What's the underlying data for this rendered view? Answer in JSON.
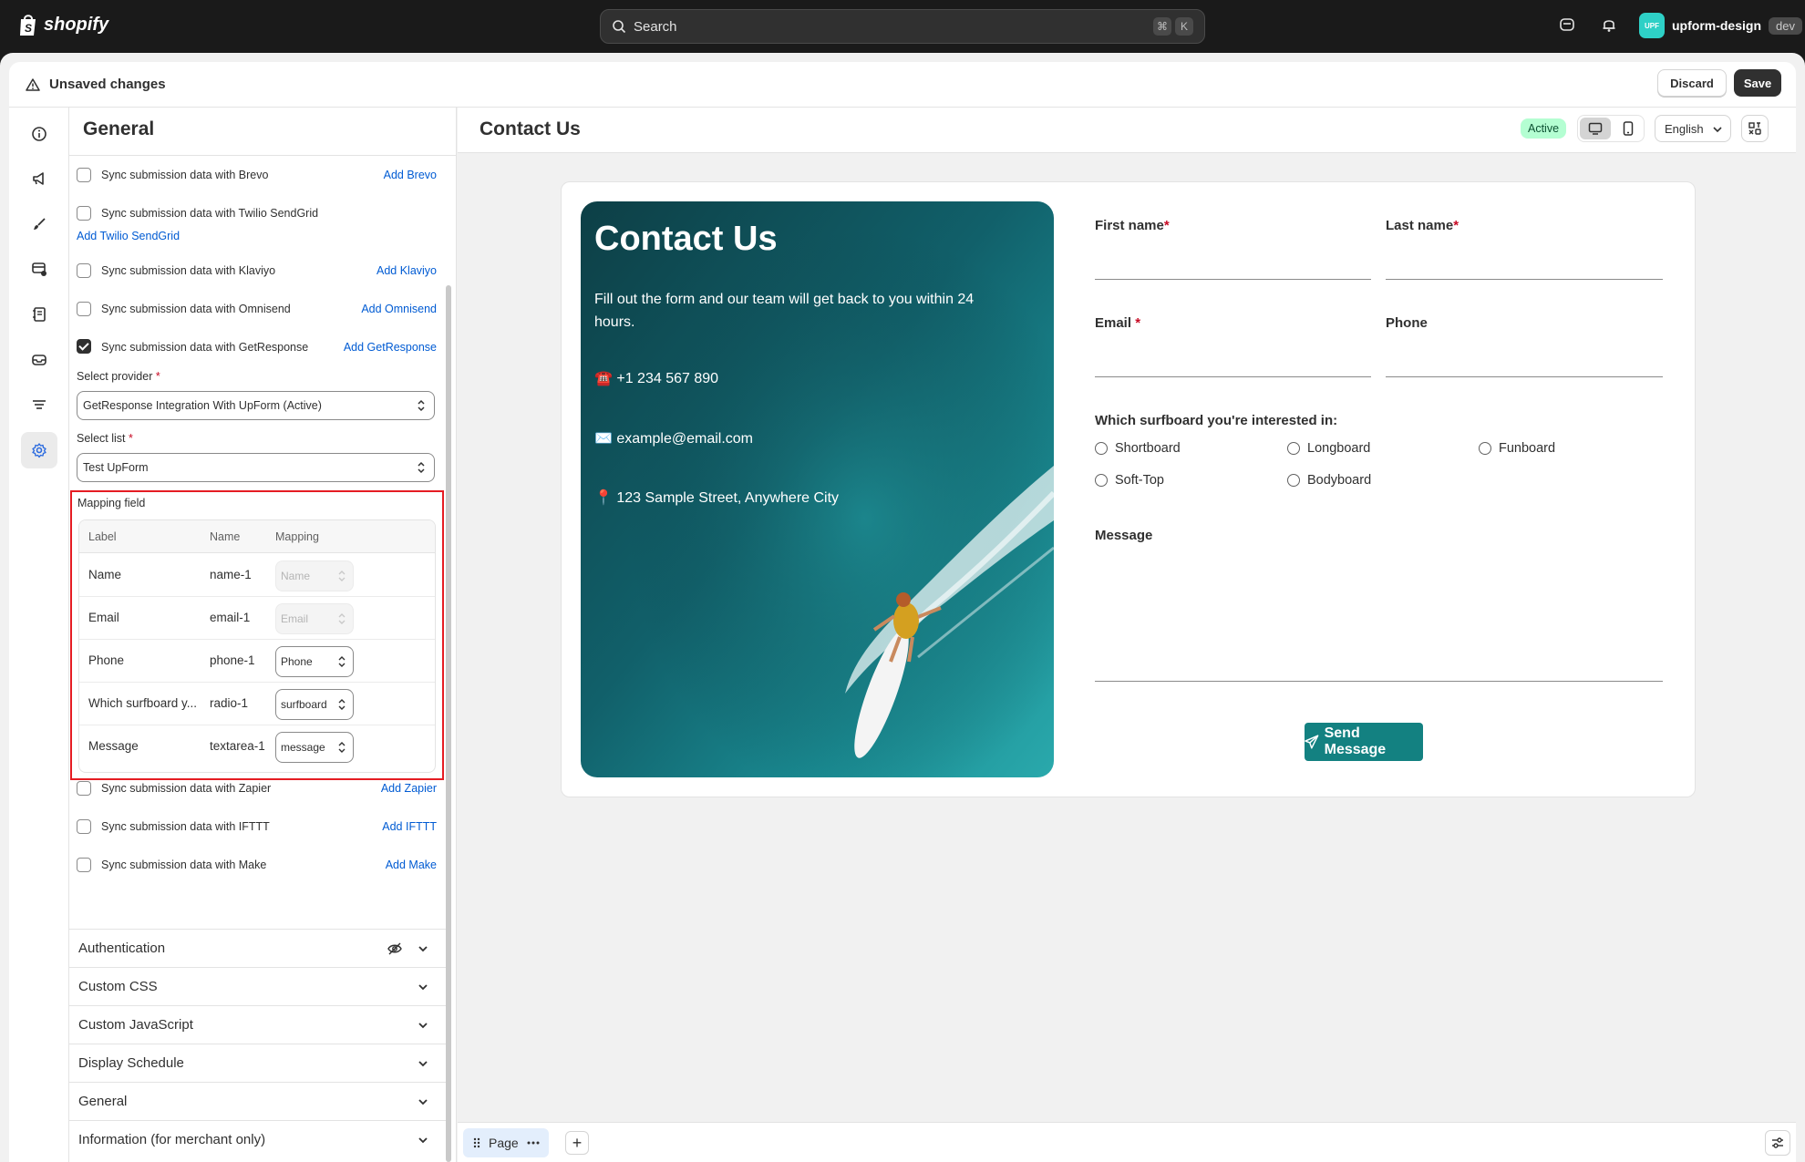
{
  "topbar": {
    "brand": "shopify",
    "search_placeholder": "Search",
    "shortcut_keys": [
      "⌘",
      "K"
    ],
    "store_avatar": "UPF",
    "store_name": "upform-design",
    "store_badge": "dev"
  },
  "savebar": {
    "title": "Unsaved changes",
    "discard_label": "Discard",
    "save_label": "Save"
  },
  "rail": {
    "icons": [
      "info-icon",
      "megaphone-icon",
      "brush-icon",
      "payment-icon",
      "notebook-icon",
      "email-icon",
      "filter-icon",
      "gear-icon"
    ],
    "active": "gear-icon"
  },
  "panel": {
    "title": "General",
    "integrations_top": [
      {
        "label": "Sync submission data with Brevo",
        "link": "Add Brevo",
        "checked": false
      },
      {
        "label": "Sync submission data with Twilio SendGrid",
        "link": "Add Twilio SendGrid",
        "checked": false
      },
      {
        "label": "Sync submission data with Klaviyo",
        "link": "Add Klaviyo",
        "checked": false
      },
      {
        "label": "Sync submission data with Omnisend",
        "link": "Add Omnisend",
        "checked": false
      },
      {
        "label": "Sync submission data with GetResponse",
        "link": "Add GetResponse",
        "checked": true
      }
    ],
    "provider": {
      "label": "Select provider",
      "required_mark": "*",
      "value": "GetResponse Integration With UpForm (Active)"
    },
    "list": {
      "label": "Select list",
      "required_mark": "*",
      "value": "Test UpForm"
    },
    "mapping": {
      "title": "Mapping field",
      "headers": [
        "Label",
        "Name",
        "Mapping"
      ],
      "rows": [
        {
          "label": "Name",
          "name": "name-1",
          "mapping": "Name",
          "disabled": true
        },
        {
          "label": "Email",
          "name": "email-1",
          "mapping": "Email",
          "disabled": true
        },
        {
          "label": "Phone",
          "name": "phone-1",
          "mapping": "Phone",
          "disabled": false
        },
        {
          "label": "Which surfboard y...",
          "name": "radio-1",
          "mapping": "surfboard",
          "disabled": false
        },
        {
          "label": "Message",
          "name": "textarea-1",
          "mapping": "message",
          "disabled": false
        }
      ]
    },
    "integrations_bottom": [
      {
        "label": "Sync submission data with Zapier",
        "link": "Add Zapier",
        "checked": false
      },
      {
        "label": "Sync submission data with IFTTT",
        "link": "Add IFTTT",
        "checked": false
      },
      {
        "label": "Sync submission data with Make",
        "link": "Add Make",
        "checked": false
      }
    ],
    "sections": [
      "Authentication",
      "Custom CSS",
      "Custom JavaScript",
      "Display Schedule",
      "General",
      "Information (for merchant only)"
    ]
  },
  "canvas": {
    "title": "Contact Us",
    "status_badge": "Active",
    "language": "English",
    "page_tab": "Page",
    "add_label": "+"
  },
  "form": {
    "hero": {
      "title": "Contact Us",
      "subtitle": "Fill out the form and our team will get back to you within 24 hours.",
      "phone": "☎️ +1 234 567 890",
      "email": "✉️ example@email.com",
      "address": "📍 123 Sample Street, Anywhere City"
    },
    "first_name": "First name",
    "last_name": "Last name",
    "email": "Email",
    "phone": "Phone",
    "required_mark": "*",
    "radio_question": "Which surfboard you're interested in:",
    "radio_options": [
      "Shortboard",
      "Longboard",
      "Funboard",
      "Soft-Top",
      "Bodyboard"
    ],
    "message": "Message",
    "submit": "Send Message"
  },
  "colors": {
    "accent_link": "#005bd3",
    "submit_button": "#138181",
    "active_badge": "#b4fed2",
    "highlight_box": "#e51c23"
  }
}
